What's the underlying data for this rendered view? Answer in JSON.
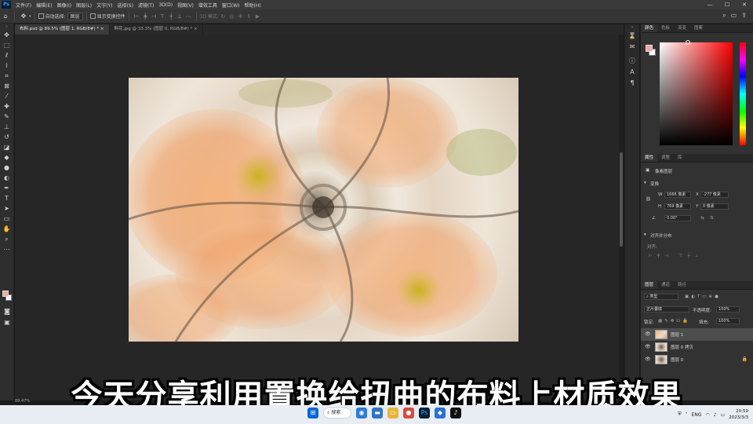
{
  "app": {
    "logo": "Ps",
    "menu": [
      "文件(F)",
      "编辑(E)",
      "图像(I)",
      "图层(L)",
      "文字(Y)",
      "选择(S)",
      "滤镜(T)",
      "3D(D)",
      "视图(V)",
      "增效工具",
      "窗口(W)",
      "帮助(H)"
    ],
    "window_controls": [
      "—",
      "☐",
      "✕"
    ]
  },
  "options_bar": {
    "auto_select_label": "自动选择:",
    "auto_select_value": "图层",
    "show_transform_label": "显示变换控件",
    "mode_3d_label": "3D 模式:"
  },
  "tabs": [
    {
      "label": "布料.psd @ 89.5% (图层 1, RGB/8#) *",
      "close": "×",
      "active": true
    },
    {
      "label": "鲜花.jpg @ 33.3% (图层 0, RGB/8#) *",
      "close": "×",
      "active": false
    }
  ],
  "status": {
    "zoom": "89.47%"
  },
  "color_panel": {
    "tabs": [
      "颜色",
      "色板",
      "渐变",
      "图案"
    ],
    "foreground": "#f0a9a0",
    "background": "#ffffff"
  },
  "properties_panel": {
    "tabs": [
      "属性",
      "调整",
      "库"
    ],
    "kind": "像素图层",
    "transform_title": "变换",
    "w_label": "W",
    "w_value": "1666 像素",
    "x_label": "X",
    "x_value": "-277 像素",
    "h_label": "H",
    "h_value": "769 像素",
    "y_label": "Y",
    "y_value": "0 像素",
    "angle_value": "0.00°",
    "align_title": "对齐并分布",
    "align_label": "对齐:"
  },
  "layers_panel": {
    "tabs": [
      "图层",
      "通道",
      "路径"
    ],
    "filter_kind": "类型",
    "blend_mode": "正片叠底",
    "opacity_label": "不透明度:",
    "opacity_value": "100%",
    "lock_label": "锁定:",
    "fill_label": "填充:",
    "fill_value": "100%",
    "layers": [
      {
        "name": "图层 1",
        "selected": true,
        "locked": false
      },
      {
        "name": "图层 0 拷贝",
        "selected": false,
        "locked": false
      },
      {
        "name": "图层 0",
        "selected": false,
        "locked": true
      }
    ]
  },
  "subtitle": "今天分享利用置换给扭曲的布料上材质效果",
  "taskbar": {
    "search_label": "搜索",
    "lang": "ENG",
    "time": "20:59",
    "date": "2023/3/3"
  }
}
